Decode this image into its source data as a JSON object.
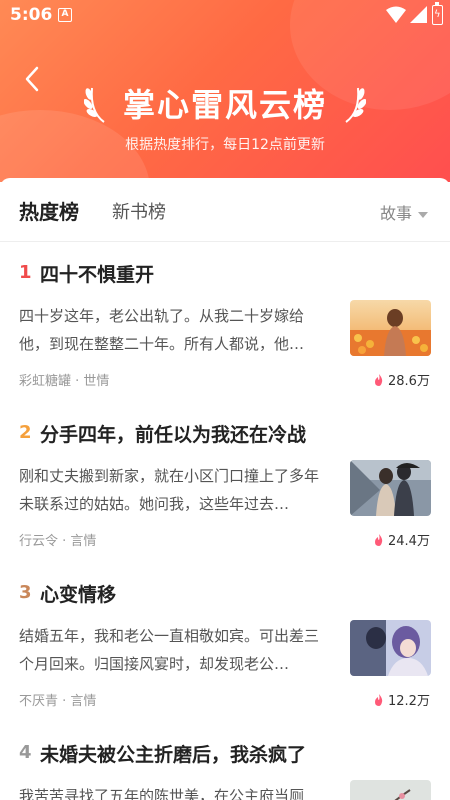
{
  "statusbar": {
    "time": "5:06",
    "notif_letter": "A"
  },
  "header": {
    "title": "掌心雷风云榜",
    "subtitle": "根据热度排行，每日12点前更新"
  },
  "tabs": {
    "hot": "热度榜",
    "new": "新书榜",
    "filter": "故事"
  },
  "colors": {
    "hero_start": "#ff8a55",
    "hero_end": "#ff4f4f",
    "rank1": "#f04b4b",
    "rank2": "#f5a03c",
    "rank3": "#c9875a",
    "rank4": "#999999",
    "flame": "#ff5a78"
  },
  "items": [
    {
      "rank": "1",
      "title": "四十不惧重开",
      "desc": "四十岁这年，老公出轨了。从我二十岁嫁给他，到现在整整二十年。所有人都说，他…",
      "meta": "彩虹糖罐 · 世情",
      "heat": "28.6万",
      "cover_icon": "tulip-field-cover"
    },
    {
      "rank": "2",
      "title": "分手四年，前任以为我还在冷战",
      "desc": "刚和丈夫搬到新家，就在小区门口撞上了多年未联系过的姑姑。她问我，这些年过去…",
      "meta": "行云令 · 言情",
      "heat": "24.4万",
      "cover_icon": "snow-couple-cover"
    },
    {
      "rank": "3",
      "title": "心变情移",
      "desc": "结婚五年，我和老公一直相敬如宾。可出差三个月回来。归国接风宴时，却发现老公…",
      "meta": "不厌青 · 言情",
      "heat": "12.2万",
      "cover_icon": "anime-couple-cover"
    },
    {
      "rank": "4",
      "title": "未婚夫被公主折磨后，我杀疯了",
      "desc": "我苦苦寻找了五年的陈世美，在公主府当厕",
      "meta": "",
      "heat": "",
      "cover_icon": "plum-blossom-cover"
    }
  ]
}
